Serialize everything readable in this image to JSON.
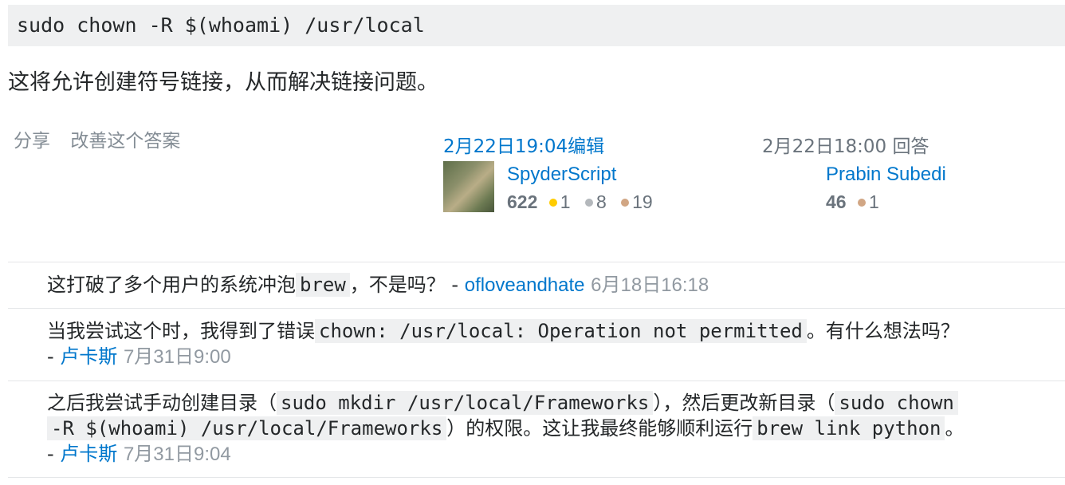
{
  "code_block": "sudo chown -R $(whoami) /usr/local",
  "explanation": "这将允许创建符号链接，从而解决链接问题。",
  "post_menu": {
    "share": "分享",
    "improve": "改善这个答案"
  },
  "editor": {
    "action": "2月22日19:04编辑",
    "name": "SpyderScript",
    "reputation": "622",
    "gold": "1",
    "silver": "8",
    "bronze": "19"
  },
  "author": {
    "action": "2月22日18:00 回答",
    "name": "Prabin Subedi",
    "reputation": "46",
    "bronze": "1"
  },
  "comments": [
    {
      "text_before": "这打破了多个用户的系统冲泡",
      "code": "brew",
      "text_after": "，不是吗？ - ",
      "user": "ofloveandhate",
      "date": "6月18日16:18"
    },
    {
      "text_before": "当我尝试这个时，我得到了错误",
      "code": "chown: /usr/local: Operation not permitted",
      "text_after": "。有什么想法吗？",
      "dash": "- ",
      "user": "卢卡斯",
      "date": "7月31日9:00"
    },
    {
      "text_1": "之后我尝试手动创建目录（",
      "code_1": "sudo mkdir /usr/local/Frameworks",
      "text_2": "），然后更改新目录（",
      "code_2a": "sudo chown",
      "code_2b": "-R $(whoami) /usr/local/Frameworks",
      "text_3": "）的权限。这让我最终能够顺利运行",
      "code_3": "brew link python",
      "text_4": "。",
      "dash": "- ",
      "user": "卢卡斯",
      "date": "7月31日9:04"
    }
  ]
}
